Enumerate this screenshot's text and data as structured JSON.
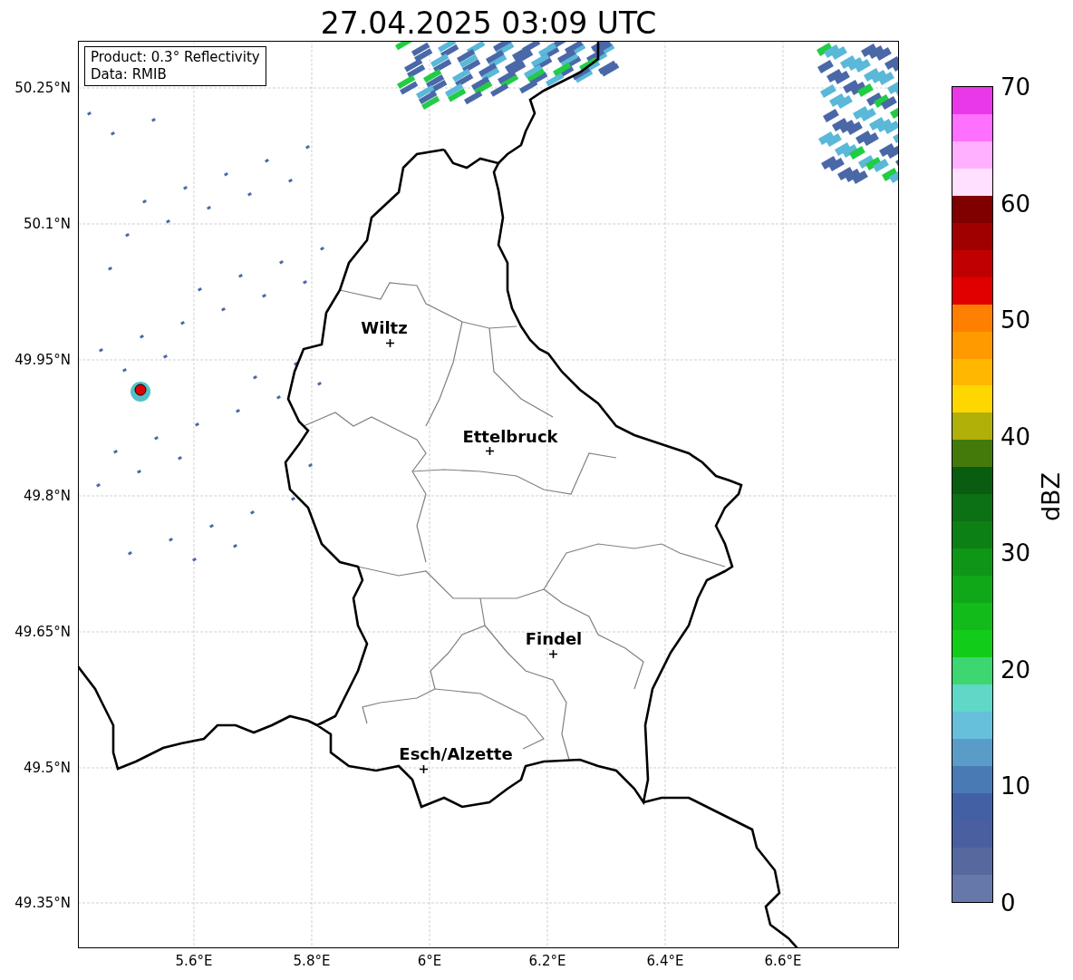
{
  "title": "27.04.2025 03:09 UTC",
  "legend": [
    "Product: 0.3° Reflectivity",
    "Data: RMIB"
  ],
  "cities": [
    {
      "name": "Wiltz"
    },
    {
      "name": "Ettelbruck"
    },
    {
      "name": "Findel"
    },
    {
      "name": "Esch/Alzette"
    }
  ],
  "y_ticks": [
    "50.25°N",
    "50.1°N",
    "49.95°N",
    "49.8°N",
    "49.65°N",
    "49.5°N",
    "49.35°N"
  ],
  "x_ticks": [
    "5.6°E",
    "5.8°E",
    "6°E",
    "6.2°E",
    "6.4°E",
    "6.6°E"
  ],
  "colorbar": {
    "label": "dBZ",
    "ticks": [
      "70",
      "60",
      "50",
      "40",
      "30",
      "20",
      "10",
      "0"
    ],
    "segments": [
      {
        "color": "#e838e8"
      },
      {
        "color": "#ff70ff"
      },
      {
        "color": "#ffb0ff"
      },
      {
        "color": "#ffe0ff"
      },
      {
        "color": "#800000"
      },
      {
        "color": "#a00000"
      },
      {
        "color": "#c00000"
      },
      {
        "color": "#e00000"
      },
      {
        "color": "#ff8000"
      },
      {
        "color": "#ff9a00"
      },
      {
        "color": "#ffb700"
      },
      {
        "color": "#ffd700"
      },
      {
        "color": "#b0b008"
      },
      {
        "color": "#447a0a"
      },
      {
        "color": "#0a5c10"
      },
      {
        "color": "#0c7014"
      },
      {
        "color": "#0c8014"
      },
      {
        "color": "#0e9616"
      },
      {
        "color": "#10a818"
      },
      {
        "color": "#12bb1a"
      },
      {
        "color": "#12cc1a"
      },
      {
        "color": "#3ed670"
      },
      {
        "color": "#60d8c8"
      },
      {
        "color": "#66c0dc"
      },
      {
        "color": "#5a9cc8"
      },
      {
        "color": "#4a7ab4"
      },
      {
        "color": "#4460a4"
      },
      {
        "color": "#4a5fa0"
      },
      {
        "color": "#56699e"
      },
      {
        "color": "#6677aa"
      }
    ]
  }
}
